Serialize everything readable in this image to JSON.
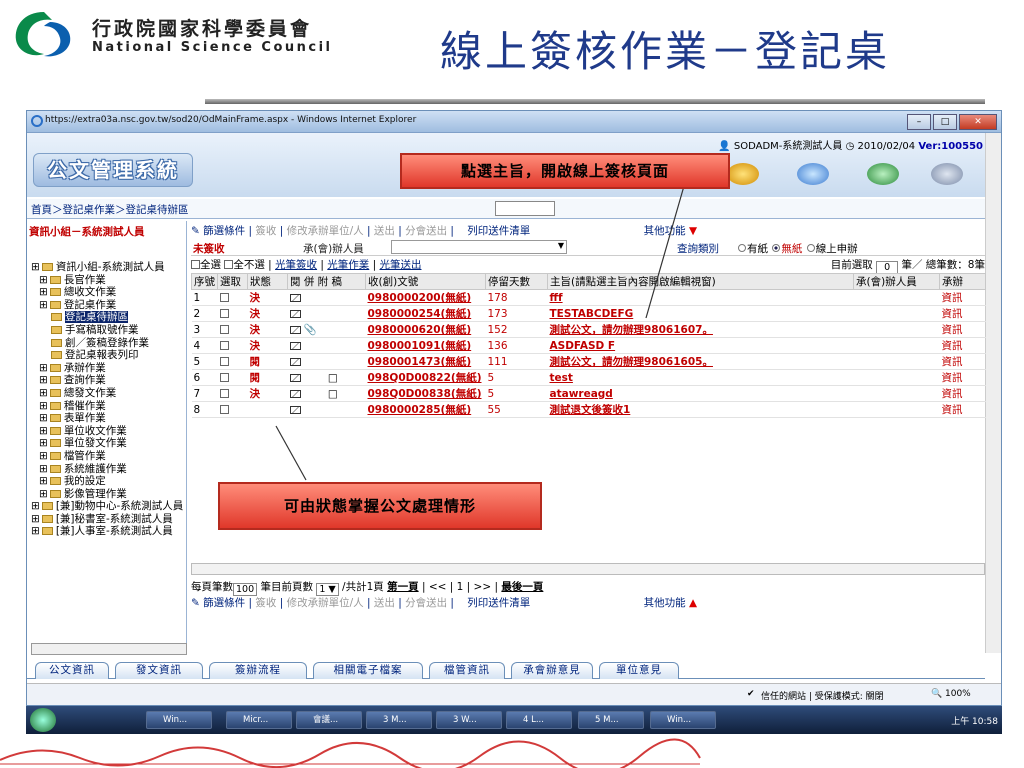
{
  "slide": {
    "org_zh": "行政院國家科學委員會",
    "org_en": "National Science Council",
    "title": "線上簽核作業－登記桌"
  },
  "window": {
    "title": "https://extra03a.nsc.gov.tw/sod20/OdMainFrame.aspx - Windows Internet Explorer",
    "system_name": "公文管理系統",
    "user_prefix": "SODADM-系統測試人員",
    "date": "2010/02/04",
    "ver_label": "Ver:",
    "ver": "100550"
  },
  "breadcrumb": "首頁＞登記桌作業＞登記桌待辦區",
  "left_panel": {
    "title": "資訊小組－系統測試人員",
    "tree": [
      {
        "text": "資訊小組-系統測試人員",
        "level": 0
      },
      {
        "text": "長官作業",
        "level": 1
      },
      {
        "text": "總收文作業",
        "level": 1
      },
      {
        "text": "登記桌作業",
        "level": 1
      },
      {
        "text": "登記桌待辦區",
        "level": 2,
        "selected": true
      },
      {
        "text": "手寫稿取號作業",
        "level": 2
      },
      {
        "text": "創／簽稿登錄作業",
        "level": 2
      },
      {
        "text": "登記桌報表列印",
        "level": 2
      },
      {
        "text": "承辦作業",
        "level": 1
      },
      {
        "text": "查詢作業",
        "level": 1
      },
      {
        "text": "總發文作業",
        "level": 1
      },
      {
        "text": "稽催作業",
        "level": 1
      },
      {
        "text": "表單作業",
        "level": 1
      },
      {
        "text": "單位收文作業",
        "level": 1
      },
      {
        "text": "單位發文作業",
        "level": 1
      },
      {
        "text": "檔管作業",
        "level": 1
      },
      {
        "text": "系統維護作業",
        "level": 1
      },
      {
        "text": "我的設定",
        "level": 1
      },
      {
        "text": "影像管理作業",
        "level": 1
      },
      {
        "text": "[兼]動物中心-系統測試人員",
        "level": 0
      },
      {
        "text": "[兼]秘書室-系統測試人員",
        "level": 0
      },
      {
        "text": "[兼]人事室-系統測試人員",
        "level": 0
      }
    ]
  },
  "toolbar": {
    "filter": "篩選條件",
    "sign": "簽收",
    "modify": "修改承辦單位/人",
    "send": "送出",
    "dept_send": "分會送出",
    "print": "列印送件清單",
    "other": "其他功能"
  },
  "filter": {
    "status": "未簽收",
    "handler_label": "承(會)辦人員",
    "query_label": "查詢類別",
    "radio_paper": "有紙",
    "radio_nopaper": "無紙",
    "radio_online": "線上申辦"
  },
  "select_row": {
    "all": "全選",
    "none": "全不選",
    "pen_sign": "光筆簽收",
    "pen_work": "光筆作業",
    "pen_send": "光筆送出",
    "current_label": "目前選取",
    "current": "0",
    "total_label": "筆／ 總筆數：8筆"
  },
  "table": {
    "headers": [
      "序號",
      "選取",
      "狀態",
      "閱 併 附 稿",
      "收(創)文號",
      "停留天數",
      "主旨(請點選主旨內容開啟編輯視窗)",
      "承(會)辦人員",
      "承辦"
    ],
    "rows": [
      {
        "no": "1",
        "state": "決",
        "att": false,
        "doc": "0980000200(無紙)",
        "days": "178",
        "subject": "fff",
        "unit": "資訊"
      },
      {
        "no": "2",
        "state": "決",
        "att": false,
        "doc": "0980000254(無紙)",
        "days": "173",
        "subject": "TESTABCDEFG",
        "unit": "資訊"
      },
      {
        "no": "3",
        "state": "決",
        "att": true,
        "doc": "0980000620(無紙)",
        "days": "152",
        "subject": "測試公文，請勿辦理98061607。",
        "unit": "資訊"
      },
      {
        "no": "4",
        "state": "決",
        "att": false,
        "doc": "0980001091(無紙)",
        "days": "136",
        "subject": "ASDFASD F",
        "unit": "資訊"
      },
      {
        "no": "5",
        "state": "閱",
        "att": false,
        "doc": "0980001473(無紙)",
        "days": "111",
        "subject": "測試公文，請勿辦理98061605。",
        "unit": "資訊"
      },
      {
        "no": "6",
        "state": "閱",
        "att": false,
        "doc": "098Q0D00822(無紙)",
        "days": "5",
        "subject": "test",
        "unit": "資訊",
        "draft": true
      },
      {
        "no": "7",
        "state": "決",
        "att": false,
        "doc": "098Q0D00838(無紙)",
        "days": "5",
        "subject": "atawreagd",
        "unit": "資訊",
        "draft": true
      },
      {
        "no": "8",
        "state": "",
        "att": false,
        "doc": "0980000285(無紙)",
        "days": "55",
        "subject": "測試退文後簽收1",
        "unit": "資訊"
      }
    ]
  },
  "pager": {
    "per_page_label": "每頁筆數",
    "per_page": "100",
    "cur_page_label": "筆目前頁數",
    "cur_page": "1",
    "total_pages": "/共計1頁",
    "first": "第一頁",
    "prev": "| << | 1",
    "next": "| >> |",
    "last": "最後一頁"
  },
  "tabs": [
    "公文資訊",
    "發文資訊",
    "簽辦流程",
    "相關電子檔案",
    "檔管資訊",
    "承會辦意見",
    "單位意見"
  ],
  "ie_status": {
    "zone": "信任的網站 | 受保護模式: 關閉",
    "zoom": "100%"
  },
  "taskbar": {
    "items": [
      "Win...",
      "Micr...",
      "會議...",
      "3 M...",
      "3 W...",
      "4 L...",
      "5 M...",
      "Win..."
    ],
    "clock": "上午 10:58"
  },
  "callouts": {
    "top": "點選主旨，開啟線上簽核頁面",
    "bottom": "可由狀態掌握公文處理情形"
  },
  "colors": {
    "title_blue": "#1f3a8a",
    "alert_red": "#c00000",
    "callout_red": "#e0372a"
  }
}
